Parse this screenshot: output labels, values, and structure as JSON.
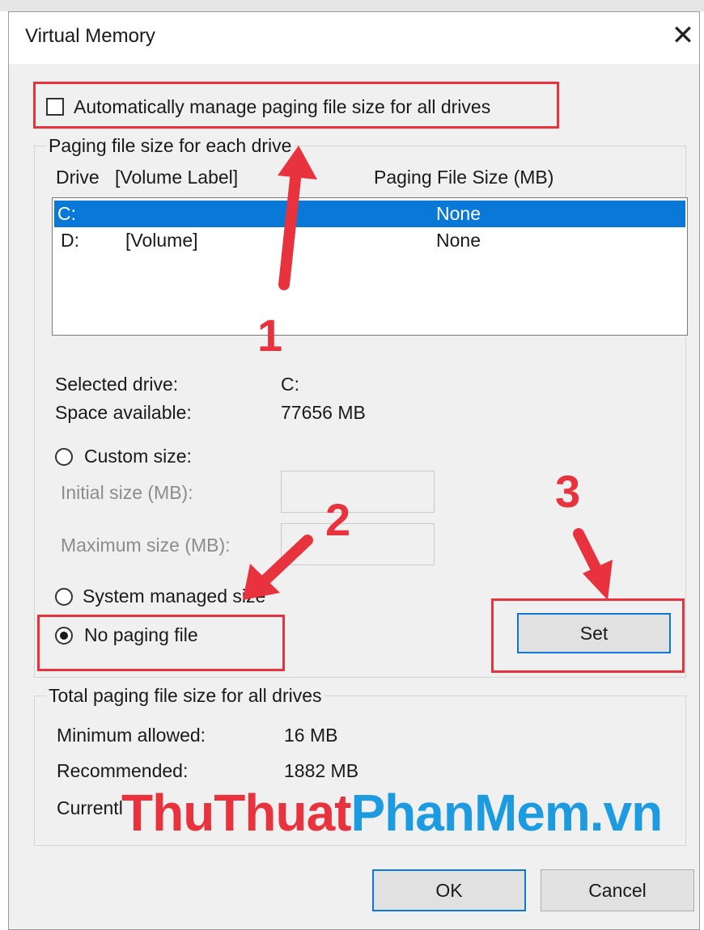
{
  "window": {
    "title": "Virtual Memory",
    "close_glyph": "✕"
  },
  "auto_manage": {
    "label": "Automatically manage paging file size for all drives",
    "checked": false
  },
  "paging_group": {
    "legend": "Paging file size for each drive",
    "col_drive": "Drive",
    "col_volume": "[Volume Label]",
    "col_size": "Paging File Size (MB)",
    "drives": [
      {
        "drive": "C:",
        "volume": "",
        "size": "None",
        "selected": true
      },
      {
        "drive": "D:",
        "volume": "[Volume]",
        "size": "None",
        "selected": false
      }
    ],
    "selected_drive_label": "Selected drive:",
    "selected_drive_value": "C:",
    "space_label": "Space available:",
    "space_value": "77656 MB",
    "custom_size_label": "Custom size:",
    "initial_size_label": "Initial size (MB):",
    "max_size_label": "Maximum size (MB):",
    "system_managed_label": "System managed size",
    "no_paging_label": "No paging file",
    "selected_option": "No paging file",
    "set_label": "Set"
  },
  "total_group": {
    "legend": "Total paging file size for all drives",
    "min_label": "Minimum allowed:",
    "min_value": "16 MB",
    "rec_label": "Recommended:",
    "rec_value": "1882 MB",
    "current_label": "Currentl"
  },
  "buttons": {
    "ok": "OK",
    "cancel": "Cancel"
  },
  "annotations": {
    "step1": "1",
    "step2": "2",
    "step3": "3",
    "color": "#e8333f"
  },
  "watermark": {
    "part1": "ThuThuat",
    "part2": "PhanMem.vn",
    "color1": "#e8333f",
    "color2": "#1d9be0"
  }
}
